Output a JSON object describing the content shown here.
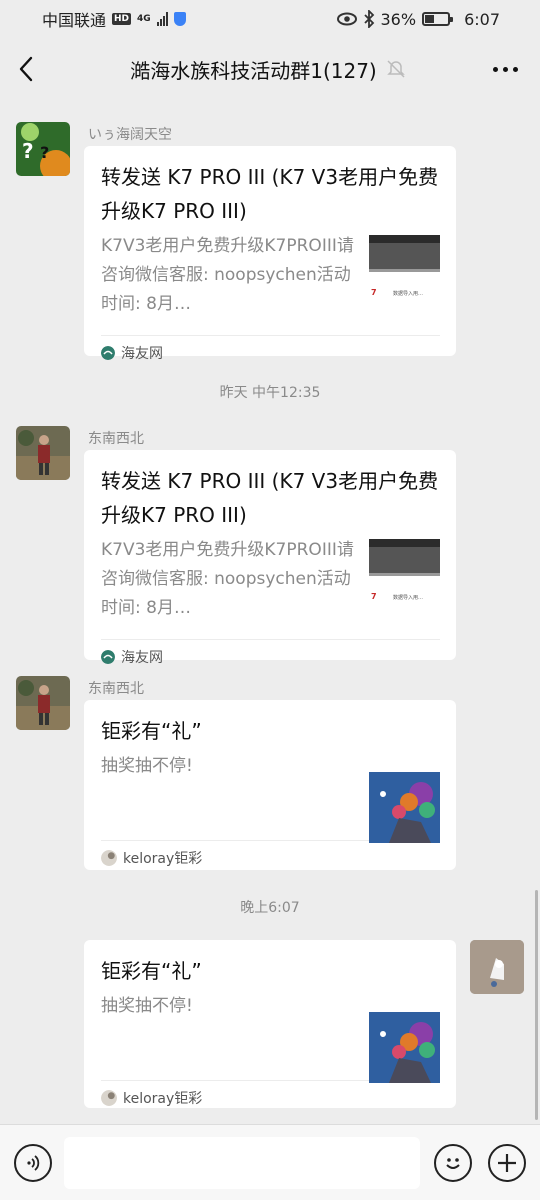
{
  "status_bar": {
    "carrier": "中国联通",
    "hd": "HD",
    "network": "4G",
    "battery_percent": "36%",
    "battery_level": 0.36,
    "time": "6:07"
  },
  "header": {
    "title": "澔海水族科技活动群1(127)"
  },
  "messages": [
    {
      "sender": "いぅ海阔天空",
      "card": {
        "title": "转发送 K7 PRO III (K7 V3老用户免费升级K7 PRO III)",
        "desc": "K7V3老用户免费升级K7PROIII请咨询微信客服: noopsychen活动时间: 8月…",
        "source": "海友网"
      }
    },
    {
      "sender": "东南西北",
      "card": {
        "title": "转发送 K7 PRO III (K7 V3老用户免费升级K7 PRO III)",
        "desc": "K7V3老用户免费升级K7PROIII请咨询微信客服: noopsychen活动时间: 8月…",
        "source": "海友网"
      }
    },
    {
      "sender": "东南西北",
      "card": {
        "title": "钜彩有“礼”",
        "desc": "抽奖抽不停!",
        "source": "keloray钜彩"
      }
    },
    {
      "sender": "",
      "card": {
        "title": "钜彩有“礼”",
        "desc": "抽奖抽不停!",
        "source": "keloray钜彩"
      }
    }
  ],
  "time_labels": [
    "昨天 中午12:35",
    "晚上6:07"
  ],
  "thumb_text": {
    "k7_brand": "7",
    "k7_caption": "数据导入用…"
  },
  "colors": {
    "background": "#ededed",
    "bubble": "#ffffff",
    "meta_text": "#8a8a8a",
    "haiyou_icon": "#2f7d6d"
  }
}
